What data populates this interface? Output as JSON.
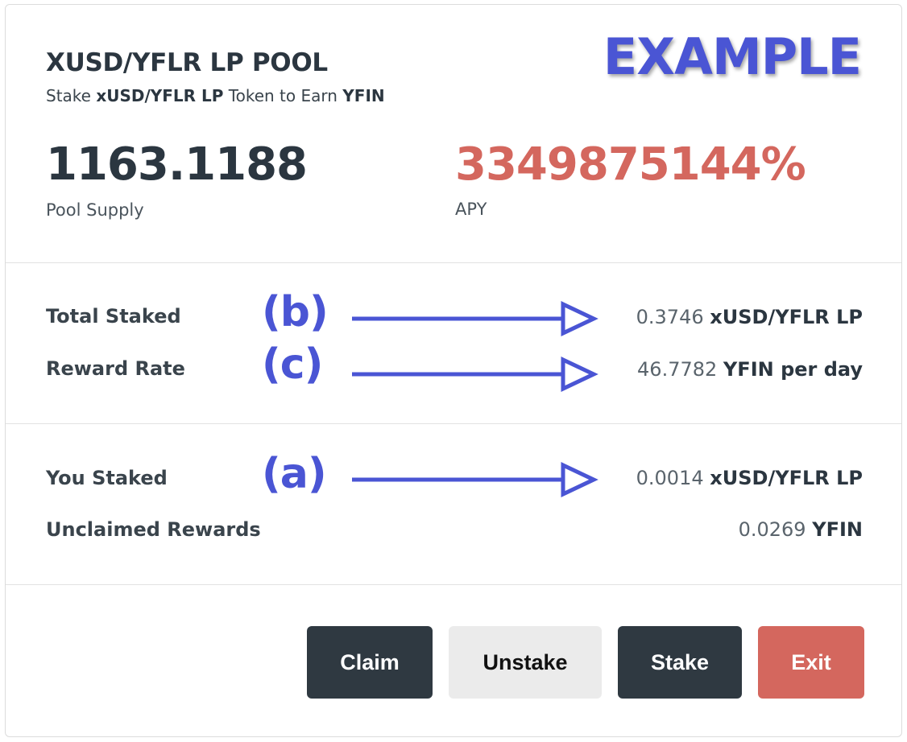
{
  "header": {
    "title": "XUSD/YFLR LP POOL",
    "subtitle_prefix": "Stake ",
    "subtitle_token": "xUSD/YFLR LP",
    "subtitle_middle": " Token to Earn ",
    "subtitle_reward": "YFIN",
    "watermark": "EXAMPLE"
  },
  "stats": {
    "pool_supply_value": "1163.1188",
    "pool_supply_label": "Pool Supply",
    "apy_value": "3349875144%",
    "apy_label": "APY"
  },
  "pool_info": {
    "total_staked_label": "Total Staked",
    "total_staked_amount": "0.3746",
    "total_staked_unit": "xUSD/YFLR LP",
    "reward_rate_label": "Reward Rate",
    "reward_rate_amount": "46.7782",
    "reward_rate_unit": "YFIN per day"
  },
  "user_info": {
    "you_staked_label": "You Staked",
    "you_staked_amount": "0.0014",
    "you_staked_unit": "xUSD/YFLR LP",
    "unclaimed_label": "Unclaimed Rewards",
    "unclaimed_amount": "0.0269",
    "unclaimed_unit": "YFIN"
  },
  "annotations": {
    "b": "(b)",
    "c": "(c)",
    "a": "(a)"
  },
  "actions": {
    "claim": "Claim",
    "unstake": "Unstake",
    "stake": "Stake",
    "exit": "Exit"
  },
  "colors": {
    "dark": "#2f3941",
    "apy_red": "#d4675e",
    "annotation_blue": "#4a55d4",
    "light_button": "#ebebeb"
  }
}
